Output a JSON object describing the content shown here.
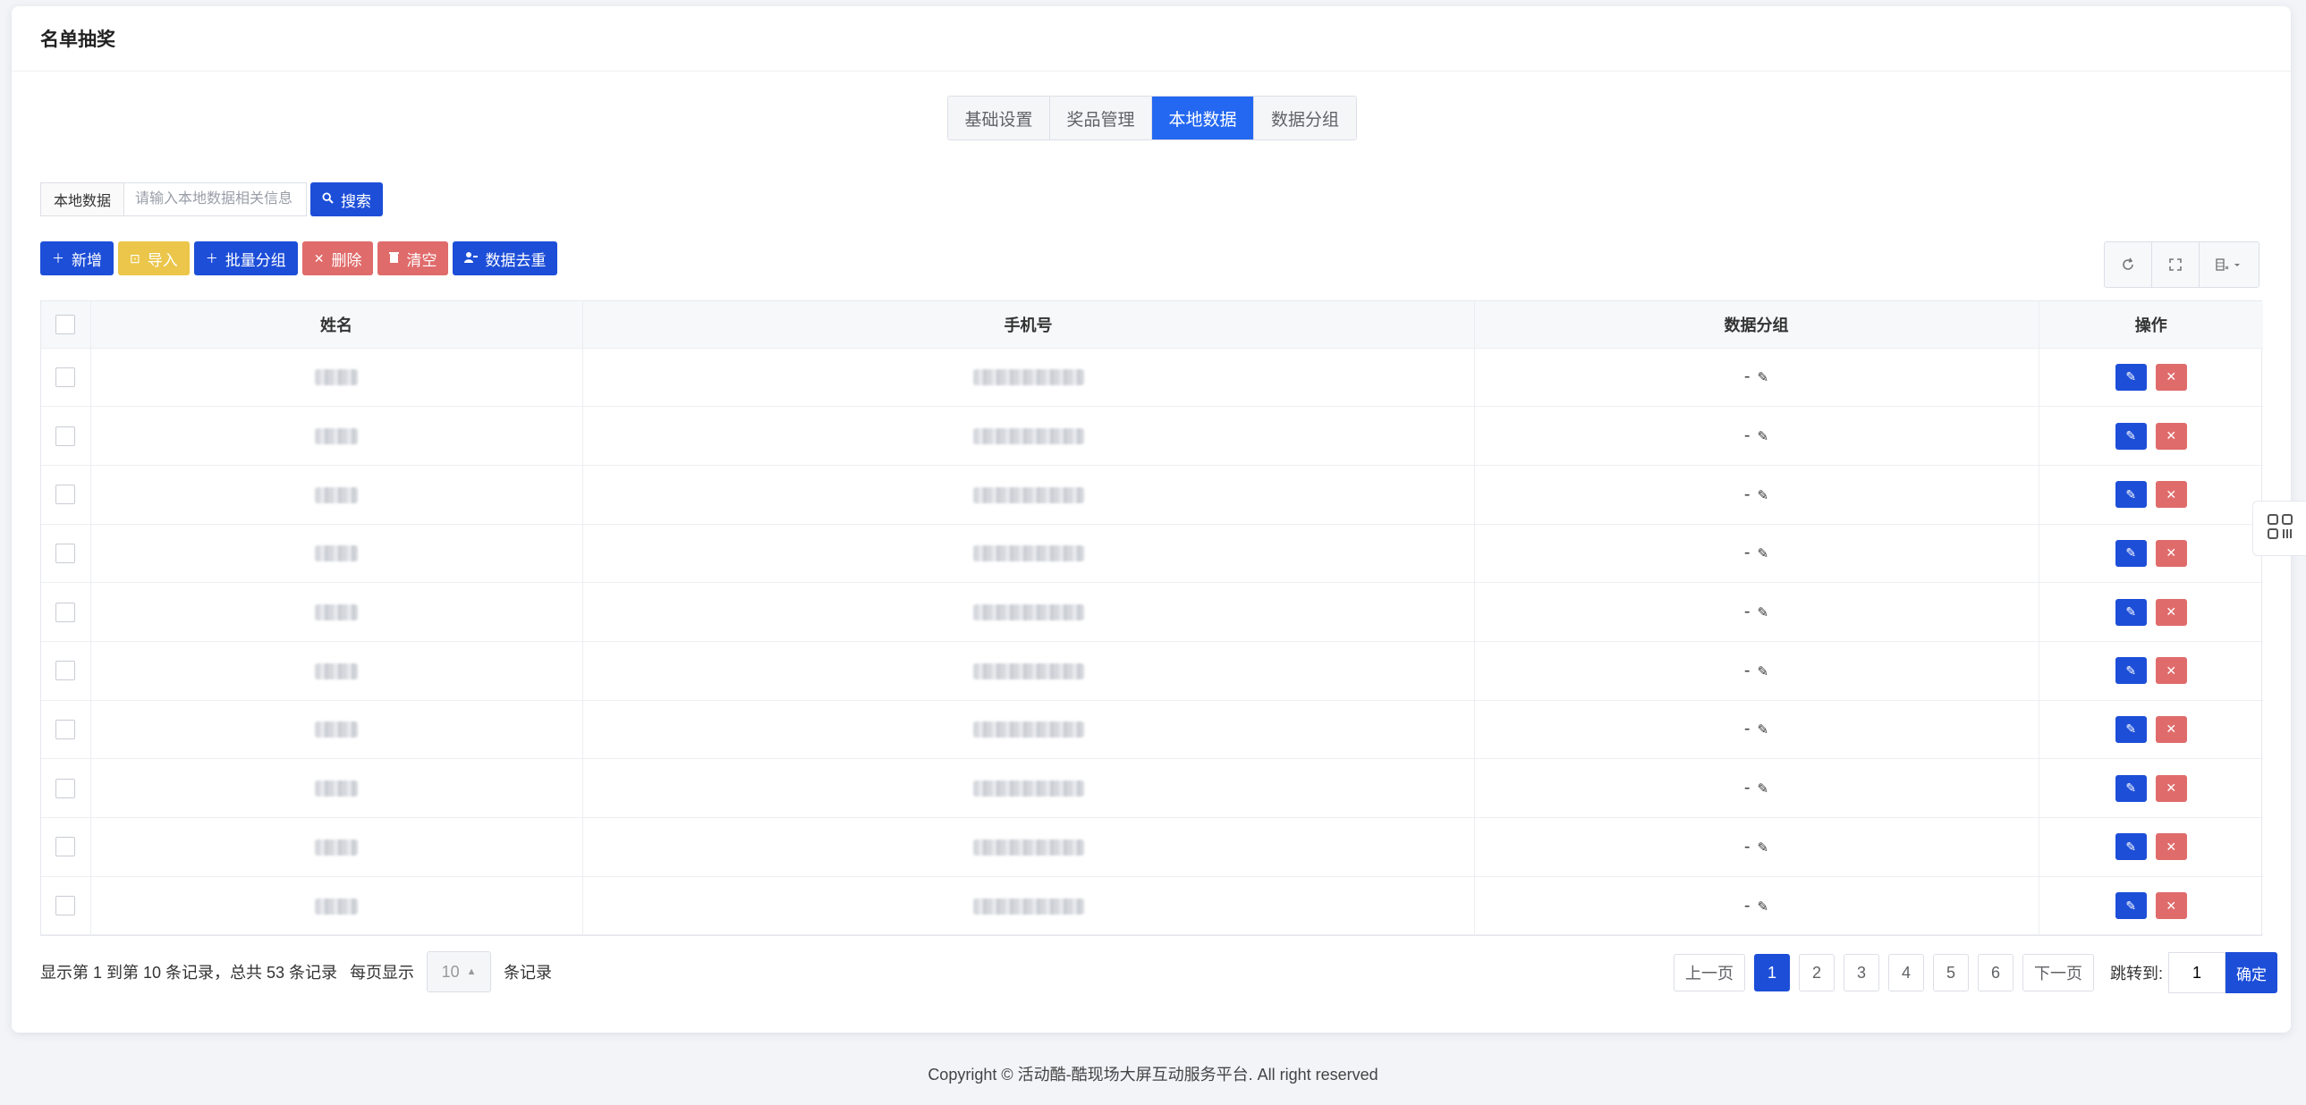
{
  "page": {
    "title": "名单抽奖"
  },
  "tabs": [
    {
      "label": "基础设置",
      "active": false
    },
    {
      "label": "奖品管理",
      "active": false
    },
    {
      "label": "本地数据",
      "active": true
    },
    {
      "label": "数据分组",
      "active": false
    }
  ],
  "search": {
    "label": "本地数据",
    "placeholder": "请输入本地数据相关信息",
    "button_label": "搜索",
    "button_icon": "search-icon"
  },
  "toolbar": {
    "add_label": "新增",
    "import_label": "导入",
    "batch_group_label": "批量分组",
    "delete_label": "删除",
    "clear_label": "清空",
    "dedupe_label": "数据去重",
    "right_tools": [
      "refresh-icon",
      "fullscreen-icon",
      "columns-icon"
    ]
  },
  "table": {
    "headers": {
      "name": "姓名",
      "phone": "手机号",
      "group": "数据分组",
      "actions": "操作"
    },
    "rows": [
      {
        "group": "-"
      },
      {
        "group": "-"
      },
      {
        "group": "-"
      },
      {
        "group": "-"
      },
      {
        "group": "-"
      },
      {
        "group": "-"
      },
      {
        "group": "-"
      },
      {
        "group": "-"
      },
      {
        "group": "-"
      },
      {
        "group": "-"
      }
    ]
  },
  "pagination": {
    "summary": "显示第 1 到第 10 条记录，总共 53 条记录",
    "per_page_label": "每页显示",
    "per_page_value": "10",
    "per_page_suffix": "条记录",
    "prev_label": "上一页",
    "next_label": "下一页",
    "pages": [
      "1",
      "2",
      "3",
      "4",
      "5",
      "6"
    ],
    "current_page": "1",
    "jump_label": "跳转到:",
    "jump_value": "1",
    "confirm_label": "确定"
  },
  "footer": {
    "copyright": "Copyright © 活动酷-酷现场大屏互动服务平台. All right reserved"
  },
  "colors": {
    "primary": "#1d4ed8",
    "tab_active": "#2468f2",
    "danger": "#e06b6b",
    "warning": "#ebc64a"
  }
}
